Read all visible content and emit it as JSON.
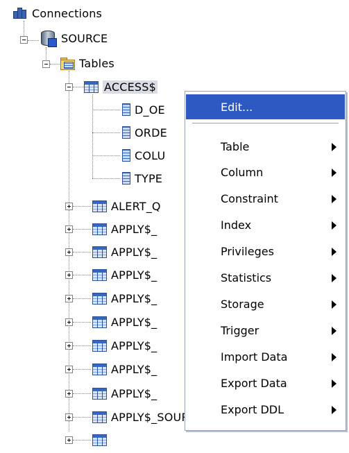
{
  "tree": {
    "connections_label": "Connections",
    "source_label": "SOURCE",
    "tables_label": "Tables",
    "access_table": "ACCESS$",
    "columns": [
      "D_OE",
      "ORDE",
      "COLU",
      "TYPE"
    ],
    "tables": [
      "ALERT_Q",
      "APPLY$_",
      "APPLY$_",
      "APPLY$_",
      "APPLY$_",
      "APPLY$_",
      "APPLY$_",
      "APPLY$_",
      "APPLY$_",
      "APPLY$_SOURCE_SCHEMA"
    ]
  },
  "menu": {
    "edit": "Edit...",
    "items": [
      {
        "label": "Table"
      },
      {
        "label": "Column"
      },
      {
        "label": "Constraint"
      },
      {
        "label": "Index"
      },
      {
        "label": "Privileges"
      },
      {
        "label": "Statistics"
      },
      {
        "label": "Storage"
      },
      {
        "label": "Trigger"
      },
      {
        "label": "Import Data"
      },
      {
        "label": "Export Data"
      },
      {
        "label": "Export DDL"
      }
    ]
  },
  "colors": {
    "highlight": "#2e58c2",
    "selected_node_bg": "#d9dce4",
    "tree_line": "#808080"
  }
}
